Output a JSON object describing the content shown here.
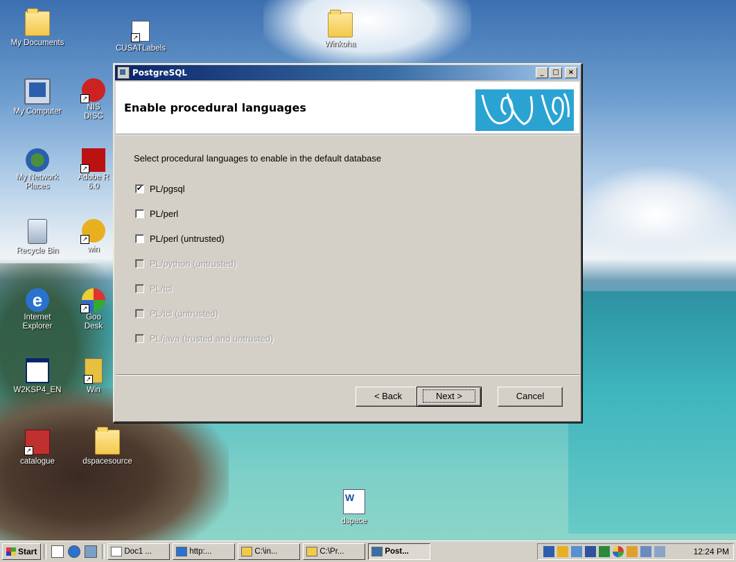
{
  "desktop": {
    "icons": [
      {
        "label": "My Documents",
        "icon": "my-documents-icon"
      },
      {
        "label": "CUSATLabels",
        "icon": "shortcut-file-icon"
      },
      {
        "label": "Winkoha",
        "icon": "folder-icon"
      },
      {
        "label": "My Computer",
        "icon": "my-computer-icon"
      },
      {
        "label": "NIS\nDISC",
        "icon": "nis-disc-shortcut-icon"
      },
      {
        "label": "My Network\nPlaces",
        "icon": "my-network-places-icon"
      },
      {
        "label": "Adobe R\n6.0",
        "icon": "adobe-reader-shortcut-icon"
      },
      {
        "label": "Recycle Bin",
        "icon": "recycle-bin-icon"
      },
      {
        "label": "win",
        "icon": "setup-shortcut-icon"
      },
      {
        "label": "Internet\nExplorer",
        "icon": "internet-explorer-icon"
      },
      {
        "label": "Goo\nDesk",
        "icon": "google-desktop-shortcut-icon"
      },
      {
        "label": "W2KSP4_EN",
        "icon": "application-window-icon"
      },
      {
        "label": "Win",
        "icon": "win-shortcut-icon"
      },
      {
        "label": "catalogue",
        "icon": "catalogue-shortcut-icon"
      },
      {
        "label": "dspacesource",
        "icon": "folder-icon"
      },
      {
        "label": "dspace",
        "icon": "word-document-icon"
      }
    ]
  },
  "dialog": {
    "title": "PostgreSQL",
    "heading": "Enable procedural languages",
    "intro": "Select procedural languages to enable in the default database",
    "options": [
      {
        "label": "PL/pgsql",
        "checked": true,
        "enabled": true
      },
      {
        "label": "PL/perl",
        "checked": false,
        "enabled": true
      },
      {
        "label": "PL/perl (untrusted)",
        "checked": false,
        "enabled": true
      },
      {
        "label": "PL/python (untrusted)",
        "checked": false,
        "enabled": false
      },
      {
        "label": "PL/tcl",
        "checked": false,
        "enabled": false
      },
      {
        "label": "PL/tcl (untrusted)",
        "checked": false,
        "enabled": false
      },
      {
        "label": "PL/java (trusted and untrusted)",
        "checked": false,
        "enabled": false
      }
    ],
    "buttons": {
      "back": "< Back",
      "next": "Next >",
      "cancel": "Cancel"
    },
    "window_controls": {
      "minimize": "_",
      "maximize": "□",
      "close": "×"
    }
  },
  "taskbar": {
    "start_label": "Start",
    "tasks": [
      {
        "label": "Doc1 ...",
        "active": false
      },
      {
        "label": "http:...",
        "active": false
      },
      {
        "label": "C:\\in...",
        "active": false
      },
      {
        "label": "C:\\Pr...",
        "active": false
      },
      {
        "label": "Post...",
        "active": true
      }
    ],
    "clock": "12:24 PM"
  },
  "colors": {
    "titlebar": "#0a246a",
    "logo_bg": "#2aa3d3",
    "face": "#d4d0c8"
  }
}
